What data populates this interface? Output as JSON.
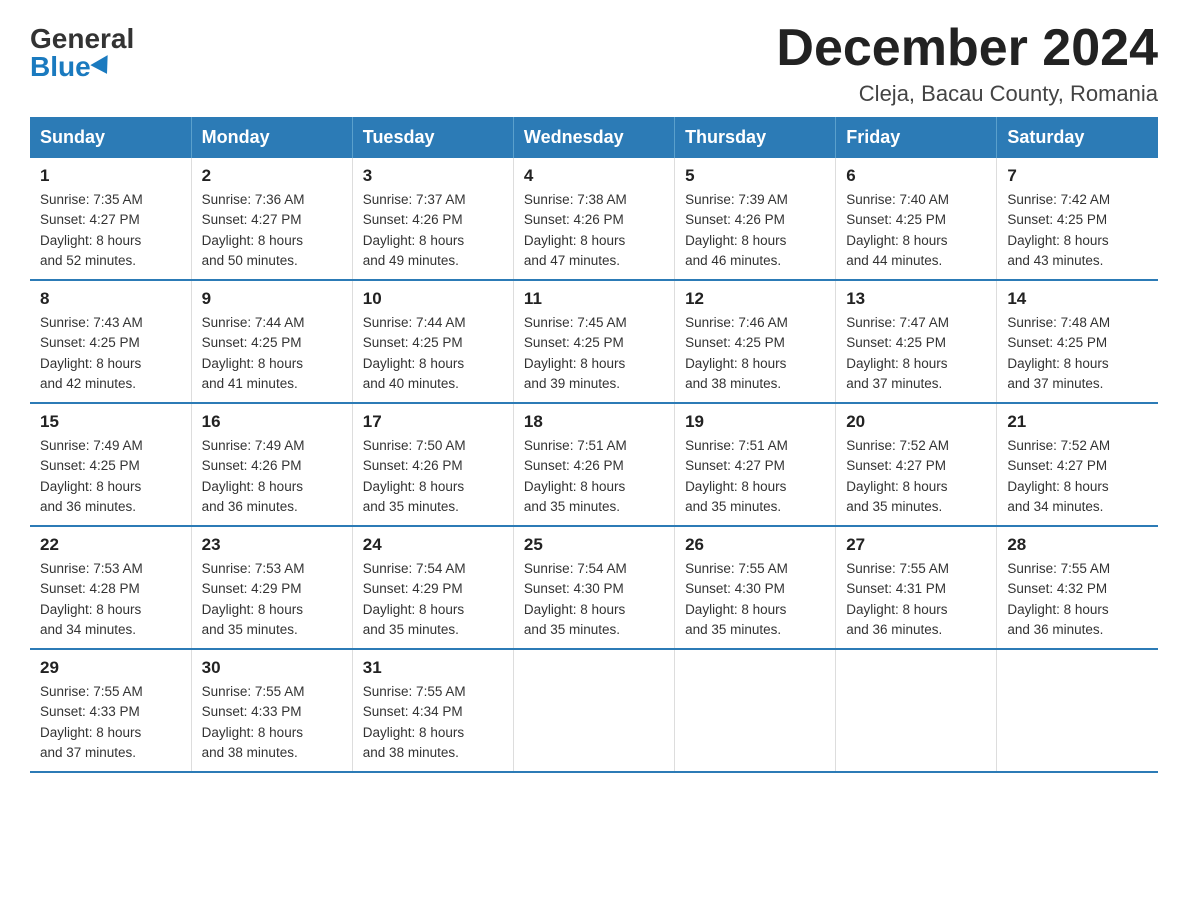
{
  "header": {
    "logo_general": "General",
    "logo_blue": "Blue",
    "month_title": "December 2024",
    "location": "Cleja, Bacau County, Romania"
  },
  "days_of_week": [
    "Sunday",
    "Monday",
    "Tuesday",
    "Wednesday",
    "Thursday",
    "Friday",
    "Saturday"
  ],
  "weeks": [
    [
      {
        "day": "1",
        "sunrise": "7:35 AM",
        "sunset": "4:27 PM",
        "daylight": "8 hours and 52 minutes."
      },
      {
        "day": "2",
        "sunrise": "7:36 AM",
        "sunset": "4:27 PM",
        "daylight": "8 hours and 50 minutes."
      },
      {
        "day": "3",
        "sunrise": "7:37 AM",
        "sunset": "4:26 PM",
        "daylight": "8 hours and 49 minutes."
      },
      {
        "day": "4",
        "sunrise": "7:38 AM",
        "sunset": "4:26 PM",
        "daylight": "8 hours and 47 minutes."
      },
      {
        "day": "5",
        "sunrise": "7:39 AM",
        "sunset": "4:26 PM",
        "daylight": "8 hours and 46 minutes."
      },
      {
        "day": "6",
        "sunrise": "7:40 AM",
        "sunset": "4:25 PM",
        "daylight": "8 hours and 44 minutes."
      },
      {
        "day": "7",
        "sunrise": "7:42 AM",
        "sunset": "4:25 PM",
        "daylight": "8 hours and 43 minutes."
      }
    ],
    [
      {
        "day": "8",
        "sunrise": "7:43 AM",
        "sunset": "4:25 PM",
        "daylight": "8 hours and 42 minutes."
      },
      {
        "day": "9",
        "sunrise": "7:44 AM",
        "sunset": "4:25 PM",
        "daylight": "8 hours and 41 minutes."
      },
      {
        "day": "10",
        "sunrise": "7:44 AM",
        "sunset": "4:25 PM",
        "daylight": "8 hours and 40 minutes."
      },
      {
        "day": "11",
        "sunrise": "7:45 AM",
        "sunset": "4:25 PM",
        "daylight": "8 hours and 39 minutes."
      },
      {
        "day": "12",
        "sunrise": "7:46 AM",
        "sunset": "4:25 PM",
        "daylight": "8 hours and 38 minutes."
      },
      {
        "day": "13",
        "sunrise": "7:47 AM",
        "sunset": "4:25 PM",
        "daylight": "8 hours and 37 minutes."
      },
      {
        "day": "14",
        "sunrise": "7:48 AM",
        "sunset": "4:25 PM",
        "daylight": "8 hours and 37 minutes."
      }
    ],
    [
      {
        "day": "15",
        "sunrise": "7:49 AM",
        "sunset": "4:25 PM",
        "daylight": "8 hours and 36 minutes."
      },
      {
        "day": "16",
        "sunrise": "7:49 AM",
        "sunset": "4:26 PM",
        "daylight": "8 hours and 36 minutes."
      },
      {
        "day": "17",
        "sunrise": "7:50 AM",
        "sunset": "4:26 PM",
        "daylight": "8 hours and 35 minutes."
      },
      {
        "day": "18",
        "sunrise": "7:51 AM",
        "sunset": "4:26 PM",
        "daylight": "8 hours and 35 minutes."
      },
      {
        "day": "19",
        "sunrise": "7:51 AM",
        "sunset": "4:27 PM",
        "daylight": "8 hours and 35 minutes."
      },
      {
        "day": "20",
        "sunrise": "7:52 AM",
        "sunset": "4:27 PM",
        "daylight": "8 hours and 35 minutes."
      },
      {
        "day": "21",
        "sunrise": "7:52 AM",
        "sunset": "4:27 PM",
        "daylight": "8 hours and 34 minutes."
      }
    ],
    [
      {
        "day": "22",
        "sunrise": "7:53 AM",
        "sunset": "4:28 PM",
        "daylight": "8 hours and 34 minutes."
      },
      {
        "day": "23",
        "sunrise": "7:53 AM",
        "sunset": "4:29 PM",
        "daylight": "8 hours and 35 minutes."
      },
      {
        "day": "24",
        "sunrise": "7:54 AM",
        "sunset": "4:29 PM",
        "daylight": "8 hours and 35 minutes."
      },
      {
        "day": "25",
        "sunrise": "7:54 AM",
        "sunset": "4:30 PM",
        "daylight": "8 hours and 35 minutes."
      },
      {
        "day": "26",
        "sunrise": "7:55 AM",
        "sunset": "4:30 PM",
        "daylight": "8 hours and 35 minutes."
      },
      {
        "day": "27",
        "sunrise": "7:55 AM",
        "sunset": "4:31 PM",
        "daylight": "8 hours and 36 minutes."
      },
      {
        "day": "28",
        "sunrise": "7:55 AM",
        "sunset": "4:32 PM",
        "daylight": "8 hours and 36 minutes."
      }
    ],
    [
      {
        "day": "29",
        "sunrise": "7:55 AM",
        "sunset": "4:33 PM",
        "daylight": "8 hours and 37 minutes."
      },
      {
        "day": "30",
        "sunrise": "7:55 AM",
        "sunset": "4:33 PM",
        "daylight": "8 hours and 38 minutes."
      },
      {
        "day": "31",
        "sunrise": "7:55 AM",
        "sunset": "4:34 PM",
        "daylight": "8 hours and 38 minutes."
      },
      null,
      null,
      null,
      null
    ]
  ],
  "labels": {
    "sunrise": "Sunrise:",
    "sunset": "Sunset:",
    "daylight": "Daylight:"
  }
}
